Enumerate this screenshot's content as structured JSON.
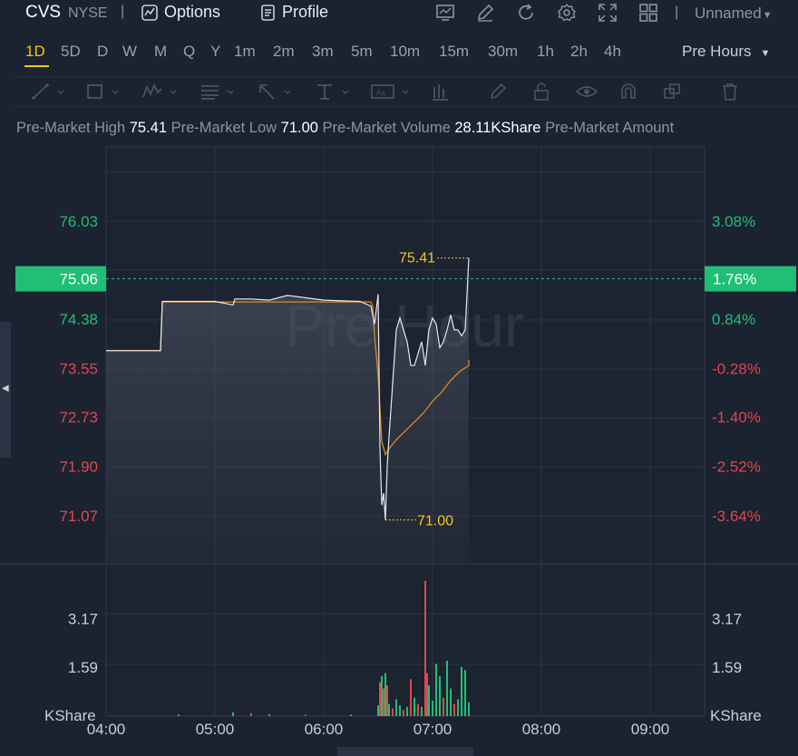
{
  "header": {
    "symbol": "CVS",
    "exchange": "NYSE",
    "separator": "|",
    "options_label": "Options",
    "profile_label": "Profile",
    "layout_name": "Unnamed",
    "icons": [
      "chart-settings-icon",
      "draw-icon",
      "refresh-icon",
      "gear-icon",
      "fullscreen-icon",
      "layout-grid-icon"
    ]
  },
  "periods": {
    "items": [
      "1D",
      "5D",
      "D",
      "W",
      "M",
      "Q",
      "Y",
      "1m",
      "2m",
      "3m",
      "5m",
      "10m",
      "15m",
      "30m",
      "1h",
      "2h",
      "4h"
    ],
    "active": "1D",
    "session_label": "Pre Hours"
  },
  "draw_tools": [
    "line-tool-icon",
    "rectangle-tool-icon",
    "wave-tool-icon",
    "fib-tool-icon",
    "arrow-tool-icon",
    "text-tool-icon",
    "annotation-tool-icon",
    "bars-tool-icon",
    "pencil-icon",
    "lock-icon",
    "eye-icon",
    "magnet-icon",
    "clone-icon",
    "trash-icon"
  ],
  "info": {
    "high_label": "Pre-Market High",
    "high_value": "75.41",
    "low_label": "Pre-Market Low",
    "low_value": "71.00",
    "volume_label": "Pre-Market Volume",
    "volume_value": "28.11KShare",
    "amount_label": "Pre-Market Amount"
  },
  "colors": {
    "up": "#1fbf75",
    "down": "#e0474f",
    "price_line": "#e6e8ee",
    "avg_line": "#e08a1e",
    "marker": "#f5c518",
    "current_price_bg": "#1fbf75"
  },
  "chart_data": {
    "type": "line",
    "watermark": "Pre Hour",
    "x_ticks": [
      "04:00",
      "05:00",
      "06:00",
      "07:00",
      "08:00",
      "09:00"
    ],
    "x_range": [
      "04:00",
      "09:30"
    ],
    "y_ticks_left": [
      "76.03",
      "74.38",
      "73.55",
      "72.73",
      "71.90",
      "71.07"
    ],
    "y_ticks_right": [
      "3.08%",
      "0.84%",
      "-0.28%",
      "-1.40%",
      "-2.52%",
      "-3.64%"
    ],
    "ylim": [
      70.3,
      77.0
    ],
    "current_price": "75.06",
    "current_change": "1.76%",
    "high_marker": "75.41",
    "low_marker": "71.00",
    "price_series": {
      "x": [
        "04:00",
        "04:30",
        "04:31",
        "05:00",
        "05:10",
        "05:11",
        "05:20",
        "05:30",
        "05:40",
        "06:00",
        "06:20",
        "06:26",
        "06:28",
        "06:30",
        "06:31",
        "06:32",
        "06:33",
        "06:34",
        "06:35",
        "06:36",
        "06:38",
        "06:40",
        "06:42",
        "06:44",
        "06:46",
        "06:48",
        "06:50",
        "06:52",
        "06:54",
        "06:56",
        "06:58",
        "07:00",
        "07:02",
        "07:04",
        "07:06",
        "07:08",
        "07:10",
        "07:12",
        "07:14",
        "07:16",
        "07:18",
        "07:20"
      ],
      "y": [
        73.85,
        73.85,
        74.68,
        74.68,
        74.62,
        74.72,
        74.72,
        74.7,
        74.78,
        74.7,
        74.68,
        74.6,
        74.3,
        74.8,
        72.2,
        71.25,
        71.45,
        71.0,
        71.9,
        72.4,
        73.3,
        74.2,
        74.4,
        74.2,
        74.0,
        73.6,
        73.6,
        73.8,
        74.0,
        73.6,
        74.2,
        74.4,
        74.3,
        73.9,
        74.0,
        74.2,
        74.45,
        74.2,
        74.2,
        74.1,
        74.2,
        75.41
      ]
    },
    "avg_series": {
      "x": [
        "04:00",
        "04:30",
        "04:31",
        "05:00",
        "06:00",
        "06:26",
        "06:27",
        "06:28",
        "06:30",
        "06:32",
        "06:34",
        "06:36",
        "06:40",
        "06:45",
        "06:50",
        "06:55",
        "07:00",
        "07:05",
        "07:10",
        "07:15",
        "07:20",
        "07:20"
      ],
      "y": [
        73.85,
        73.85,
        74.67,
        74.67,
        74.67,
        74.67,
        74.6,
        74.1,
        73.45,
        72.32,
        72.1,
        72.2,
        72.35,
        72.5,
        72.65,
        72.8,
        73.0,
        73.15,
        73.35,
        73.5,
        73.6,
        73.7
      ]
    },
    "volume": {
      "y_ticks": [
        "3.17",
        "1.59"
      ],
      "unit": "KShare",
      "ylim": [
        0,
        4.6
      ],
      "bars": [
        {
          "x": "04:40",
          "v": 0.05,
          "up": true
        },
        {
          "x": "05:10",
          "v": 0.12,
          "up": true
        },
        {
          "x": "05:20",
          "v": 0.1,
          "up": false
        },
        {
          "x": "05:30",
          "v": 0.06,
          "up": true
        },
        {
          "x": "05:50",
          "v": 0.05,
          "up": false
        },
        {
          "x": "06:15",
          "v": 0.05,
          "up": true
        },
        {
          "x": "06:30",
          "v": 0.35,
          "up": true
        },
        {
          "x": "06:31",
          "v": 1.1,
          "up": false
        },
        {
          "x": "06:32",
          "v": 1.3,
          "up": true
        },
        {
          "x": "06:33",
          "v": 0.9,
          "up": false
        },
        {
          "x": "06:34",
          "v": 1.4,
          "up": true
        },
        {
          "x": "06:35",
          "v": 1.0,
          "up": false
        },
        {
          "x": "06:36",
          "v": 0.4,
          "up": true
        },
        {
          "x": "06:38",
          "v": 0.25,
          "up": false
        },
        {
          "x": "06:40",
          "v": 0.55,
          "up": true
        },
        {
          "x": "06:42",
          "v": 0.35,
          "up": true
        },
        {
          "x": "06:44",
          "v": 0.2,
          "up": false
        },
        {
          "x": "06:46",
          "v": 0.3,
          "up": true
        },
        {
          "x": "06:48",
          "v": 1.2,
          "up": false
        },
        {
          "x": "06:50",
          "v": 0.6,
          "up": true
        },
        {
          "x": "06:52",
          "v": 0.4,
          "up": false
        },
        {
          "x": "06:54",
          "v": 0.3,
          "up": true
        },
        {
          "x": "06:56",
          "v": 4.4,
          "up": false
        },
        {
          "x": "06:57",
          "v": 1.4,
          "up": false
        },
        {
          "x": "06:58",
          "v": 1.0,
          "up": true
        },
        {
          "x": "07:00",
          "v": 0.5,
          "up": true
        },
        {
          "x": "07:02",
          "v": 1.7,
          "up": true
        },
        {
          "x": "07:04",
          "v": 1.3,
          "up": true
        },
        {
          "x": "07:06",
          "v": 0.6,
          "up": false
        },
        {
          "x": "07:08",
          "v": 1.8,
          "up": true
        },
        {
          "x": "07:10",
          "v": 0.9,
          "up": true
        },
        {
          "x": "07:12",
          "v": 0.4,
          "up": false
        },
        {
          "x": "07:14",
          "v": 0.55,
          "up": true
        },
        {
          "x": "07:16",
          "v": 1.6,
          "up": true
        },
        {
          "x": "07:18",
          "v": 1.5,
          "up": true
        },
        {
          "x": "07:20",
          "v": 0.45,
          "up": true
        }
      ]
    }
  }
}
